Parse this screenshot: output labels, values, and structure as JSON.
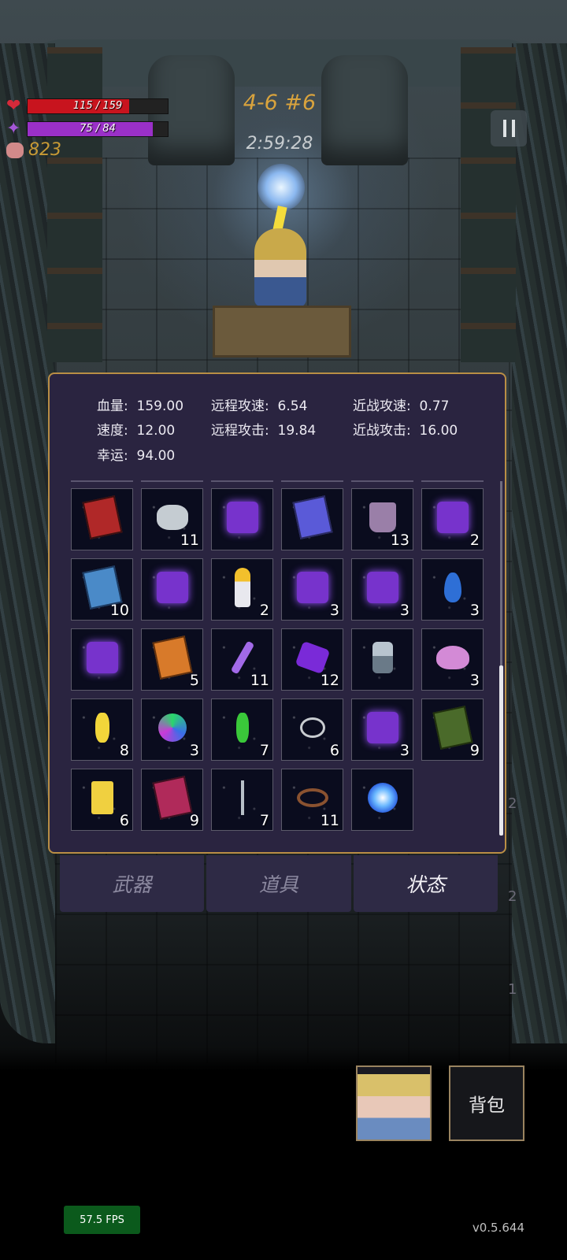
{
  "hud": {
    "hp_text": "115 / 159",
    "hp_fraction": 0.723,
    "mp_text": "75 / 84",
    "mp_fraction": 0.893,
    "coins": "823",
    "level": "4-6 #6",
    "timer": "2:59:28"
  },
  "stats": [
    {
      "label": "血量:",
      "value": "159.00"
    },
    {
      "label": "远程攻速:",
      "value": "6.54"
    },
    {
      "label": "近战攻速:",
      "value": "0.77"
    },
    {
      "label": "速度:",
      "value": "12.00"
    },
    {
      "label": "远程攻击:",
      "value": "19.84"
    },
    {
      "label": "近战攻击:",
      "value": "16.00"
    },
    {
      "label": "幸运:",
      "value": "94.00"
    }
  ],
  "items": [
    {
      "icon": "skull-book-icon",
      "count": ""
    },
    {
      "icon": "stone-icon",
      "count": "11"
    },
    {
      "icon": "hourglass-rune-icon",
      "count": ""
    },
    {
      "icon": "triangle-book-icon",
      "count": ""
    },
    {
      "icon": "boots-icon",
      "count": "13"
    },
    {
      "icon": "eye-rune-icon",
      "count": "2"
    },
    {
      "icon": "wave-book-icon",
      "count": "10"
    },
    {
      "icon": "percent-rune-icon",
      "count": ""
    },
    {
      "icon": "star-trophy-icon",
      "count": "2"
    },
    {
      "icon": "spiral-rune-icon",
      "count": "3"
    },
    {
      "icon": "cross-rune-icon",
      "count": "3"
    },
    {
      "icon": "water-drop-icon",
      "count": "3"
    },
    {
      "icon": "x-rune-icon",
      "count": ""
    },
    {
      "icon": "sun-book-icon",
      "count": "5"
    },
    {
      "icon": "vial-icon",
      "count": "11"
    },
    {
      "icon": "purple-crystal-icon",
      "count": "12"
    },
    {
      "icon": "hammer-icon",
      "count": ""
    },
    {
      "icon": "slime-icon",
      "count": "3"
    },
    {
      "icon": "yellow-gem-icon",
      "count": "8"
    },
    {
      "icon": "rainbow-orb-icon",
      "count": "3"
    },
    {
      "icon": "green-gem-icon",
      "count": "7"
    },
    {
      "icon": "rings-icon",
      "count": "6"
    },
    {
      "icon": "swirl-rune-icon",
      "count": "3"
    },
    {
      "icon": "green-book-icon",
      "count": "9"
    },
    {
      "icon": "yellow-card-icon",
      "count": "6"
    },
    {
      "icon": "red-book-icon",
      "count": "9"
    },
    {
      "icon": "hook-icon",
      "count": "7"
    },
    {
      "icon": "thorn-wreath-icon",
      "count": "11"
    },
    {
      "icon": "blue-orb-icon",
      "count": ""
    }
  ],
  "tabs": [
    {
      "label": "武器"
    },
    {
      "label": "道具"
    },
    {
      "label": "状态"
    }
  ],
  "active_tab": "状态",
  "bag_label": "背包",
  "fps": "57.5 FPS",
  "version": "v0.5.644",
  "side_counts": [
    "2",
    "2",
    "1"
  ],
  "colors": {
    "hp": "#c8141e",
    "mp": "#9a30c8",
    "level": "#d9a33d",
    "panel_border": "#b98e45"
  }
}
